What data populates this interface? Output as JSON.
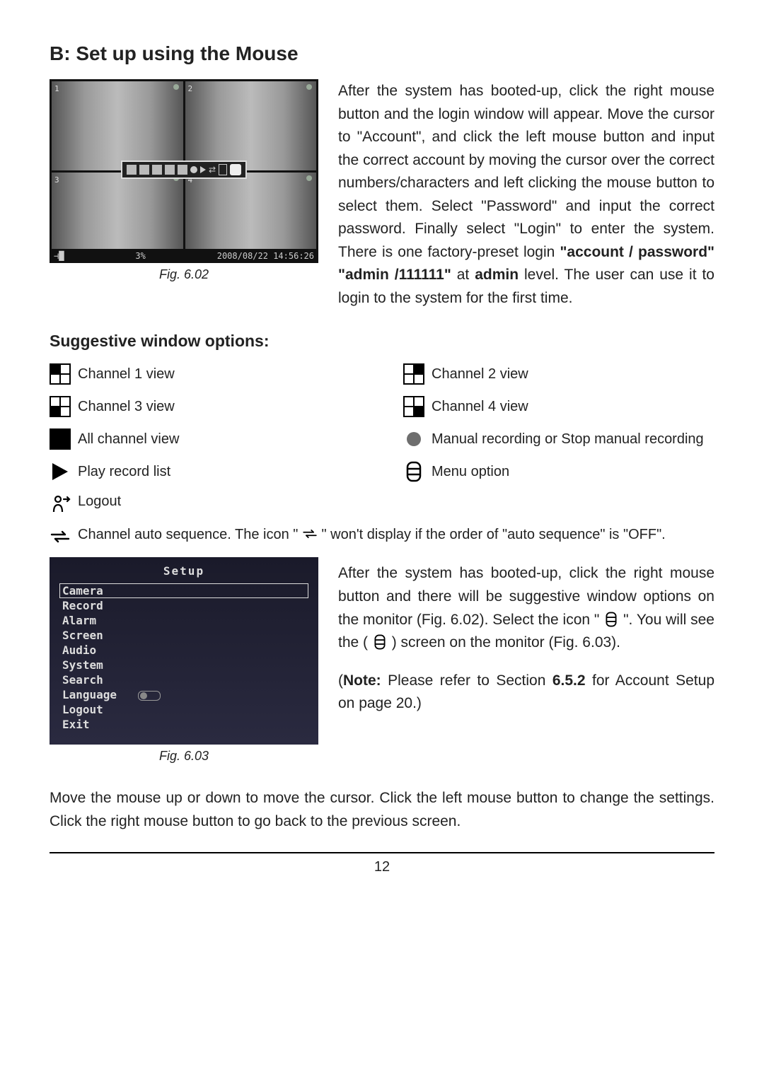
{
  "section_title": "B:  Set up using the Mouse",
  "fig602": {
    "caption": "Fig. 6.02",
    "channels": [
      "1",
      "2",
      "3",
      "4"
    ],
    "status_left": "⊣█",
    "status_mid": "3%",
    "status_right": "2008/08/22 14:56:26"
  },
  "para1_a": "After the system has booted-up, click the right mouse button and the login window will appear.  Move the cursor to \"Account\", and click the left mouse button and input the correct account by moving the cursor over the correct numbers/characters and left clicking the mouse button to select them.   Select \"Password\" and input the correct password.  Finally select \"Login\" to enter the system.   There is one factory-preset  login  ",
  "para1_b1": "\"account / password\"",
  "para1_c": " ",
  "para1_d": "\"admin /111111\"",
  "para1_e": " at ",
  "para1_f": "admin",
  "para1_g": " level.  The user can use it to login to the system for the first time.",
  "opts_heading": "Suggestive window options:",
  "opts": {
    "r1c1": "Channel 1 view",
    "r1c2": "Channel 2 view",
    "r2c1": "Channel 3 view",
    "r2c2": "Channel 4 view",
    "r3c1": "All channel view",
    "r3c2": "Manual recording or Stop manual recording",
    "r4c1": "Play record list",
    "r4c2": "Menu option",
    "r5": "Logout",
    "r6a": "Channel auto sequence.  The icon  \" ",
    "r6b": " \"  won't display if the order of \"auto sequence\" is \"OFF\"."
  },
  "fig603": {
    "caption": "Fig. 6.03",
    "title": "Setup",
    "items": [
      "Camera",
      "Record",
      "Alarm",
      "Screen",
      "Audio",
      "System",
      "Search",
      "Language",
      "Logout",
      "Exit"
    ],
    "slider_index": 7
  },
  "para2_a": "After the system has booted-up, click the right mouse button and there will be suggestive window options on the monitor (Fig. 6.02).   Select the icon \" ",
  "para2_b": " \".   You will see the ( ",
  "para2_c": " ) screen on the monitor (Fig. 6.03).",
  "note_a": "(",
  "note_b": "Note:",
  "note_c": " Please refer to Section ",
  "note_d": "6.5.2",
  "note_e": " for Account Setup on page 20.)",
  "para3": "Move the mouse up or down to move the cursor.  Click the left mouse button to change the settings.  Click the right mouse button to go back to the previous screen.",
  "page_number": "12"
}
